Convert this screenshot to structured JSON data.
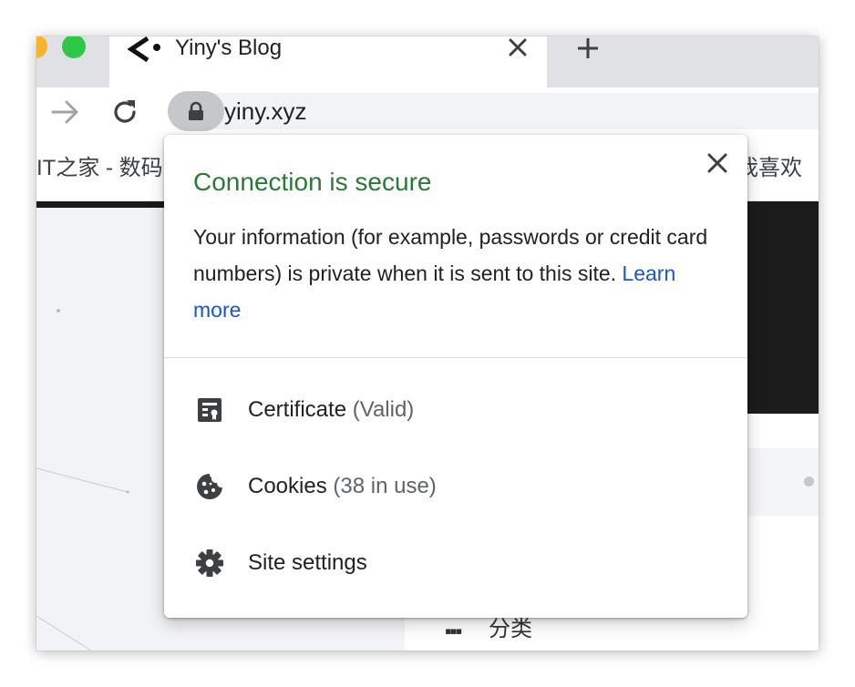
{
  "tab": {
    "title": "Yiny's Blog"
  },
  "toolbar": {
    "url": "yiny.xyz"
  },
  "bookmarks": {
    "left_label": "IT之家 - 数码",
    "right_label": "我喜欢"
  },
  "page": {
    "category_label": "分类"
  },
  "popup": {
    "title": "Connection is secure",
    "description": "Your information (for example, passwords or credit card numbers) is private when it is sent to this site.",
    "learn_more": "Learn more",
    "items": [
      {
        "label": "Certificate",
        "detail": "(Valid)",
        "icon": "certificate-icon"
      },
      {
        "label": "Cookies",
        "detail": "(38 in use)",
        "icon": "cookie-icon"
      },
      {
        "label": "Site settings",
        "detail": "",
        "icon": "gear-icon"
      }
    ]
  },
  "colors": {
    "secure_green": "#2a7a35",
    "link_blue": "#1a56c4",
    "tabstrip_gray": "#dfe1e5"
  }
}
